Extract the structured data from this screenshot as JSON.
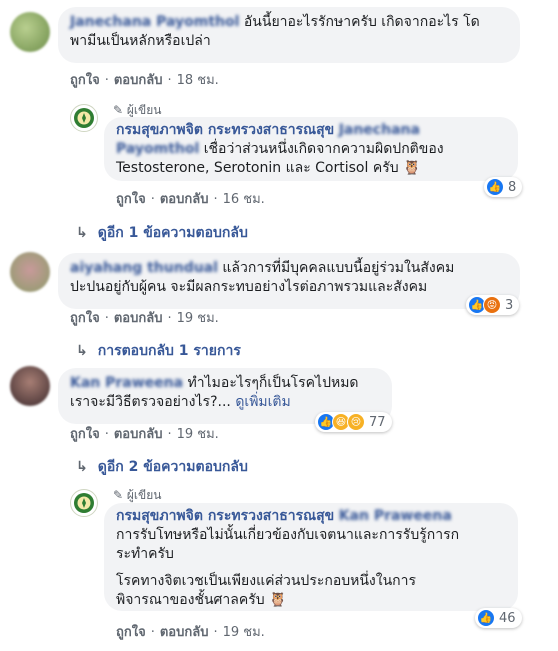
{
  "comments": [
    {
      "author": "Janechana Payomthol",
      "text_line1": "อันนี้ยาอะไรรักษาครับ เกิดจากอะไร โด",
      "text_line2": "พามีนเป็นหลักหรือเปล่า",
      "like": "ถูกใจ",
      "reply": "ตอบกลับ",
      "time": "18 ชม."
    },
    {
      "author_tag": "ผู้เขียน",
      "author": "กรมสุขภาพจิต กระทรวงสาธารณสุข",
      "mention": "Janechana Payomthol",
      "text_line1": "เชื่อว่าส่วนหนึ่งเกิดจากความผิดปกติของ",
      "text_line2": "Testosterone, Serotonin และ Cortisol ครับ",
      "reaction_count": "8",
      "like": "ถูกใจ",
      "reply": "ตอบกลับ",
      "time": "16 ชม."
    },
    {
      "more_replies": "ดูอีก 1 ข้อความตอบกลับ"
    },
    {
      "author": "aiyahang thundual",
      "text_line1": "แล้วการที่มีบุคคลแบบนี้อยู่ร่วมในสังคม",
      "text_line2": "ปะปนอยู่กับผู้คน จะมีผลกระทบอย่างไรต่อภาพรวมและสังคม",
      "reaction_count": "3",
      "like": "ถูกใจ",
      "reply": "ตอบกลับ",
      "time": "19 ชม.",
      "replies_link": "การตอบกลับ 1 รายการ"
    },
    {
      "author": "Kan Praweena",
      "text_line1": "ทำไมอะไรๆก็เป็นโรคไปหมด",
      "text_line2": "เราจะมีวิธีตรวจอย่างไร?...",
      "see_more": "ดูเพิ่มเติม",
      "reaction_count": "77",
      "like": "ถูกใจ",
      "reply": "ตอบกลับ",
      "time": "19 ชม.",
      "more_replies": "ดูอีก 2 ข้อความตอบกลับ"
    },
    {
      "author_tag": "ผู้เขียน",
      "author": "กรมสุขภาพจิต กระทรวงสาธารณสุข",
      "mention": "Kan Praweena",
      "text_line1": "การรับโทษหรือไม่นั้นเกี่ยวข้องกับเจตนาและการรับรู้การก",
      "text_line2": "ระทำครับ",
      "text_line3": "โรคทางจิตเวชเป็นเพียงแค่ส่วนประกอบหนึ่งในการ",
      "text_line4": "พิจารณาของชั้นศาลครับ",
      "reaction_count": "46",
      "like": "ถูกใจ",
      "reply": "ตอบกลับ",
      "time": "19 ชม."
    }
  ],
  "colors": {
    "link": "#385898",
    "bubble": "#f2f3f5",
    "like": "#1877f2"
  }
}
